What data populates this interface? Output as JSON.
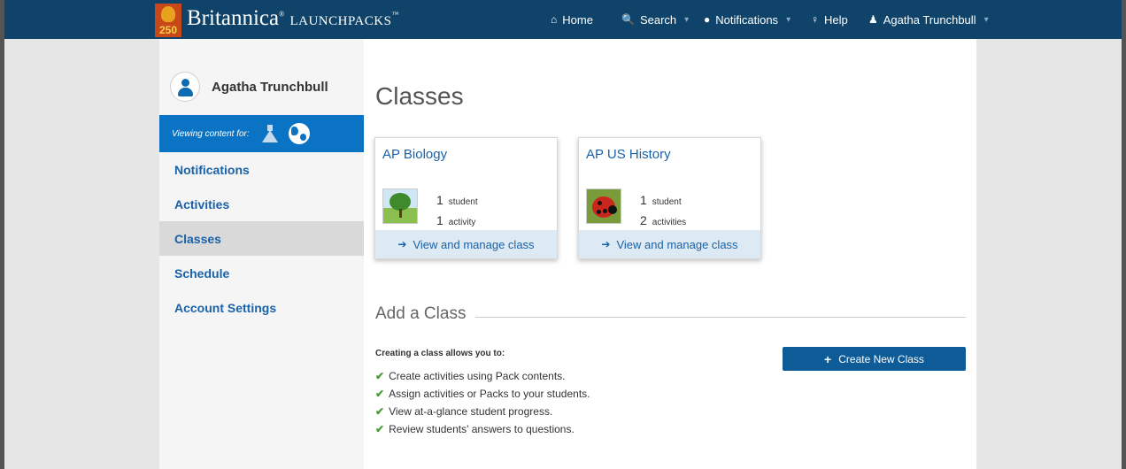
{
  "brand": {
    "name": "Britannica",
    "product": "LaunchPacks",
    "badge_number": "250"
  },
  "nav": {
    "home": "Home",
    "search": "Search",
    "notifications": "Notifications",
    "help": "Help",
    "user": "Agatha Trunchbull"
  },
  "sidebar": {
    "user_name": "Agatha Trunchbull",
    "viewing_label": "Viewing content for:",
    "items": [
      {
        "label": "Notifications"
      },
      {
        "label": "Activities"
      },
      {
        "label": "Classes"
      },
      {
        "label": "Schedule"
      },
      {
        "label": "Account Settings"
      }
    ],
    "active": "Classes"
  },
  "main": {
    "title": "Classes",
    "classes": [
      {
        "name": "AP Biology",
        "students": "1",
        "students_label": "student",
        "activities": "1",
        "activities_label": "activity",
        "link": "View and manage class"
      },
      {
        "name": "AP US History",
        "students": "1",
        "students_label": "student",
        "activities": "2",
        "activities_label": "activities",
        "link": "View and manage class"
      }
    ],
    "add_class": {
      "title": "Add a Class",
      "intro": "Creating a class allows you to:",
      "benefits": [
        "Create activities using Pack contents.",
        "Assign activities or Packs to your students.",
        "View at-a-glance student progress.",
        "Review students' answers to questions."
      ],
      "button": "Create New Class"
    }
  },
  "colors": {
    "topbar": "#0f4369",
    "accent": "#0b73c4",
    "link": "#1a62a8",
    "button": "#0e5c97",
    "check": "#4a9a35"
  }
}
